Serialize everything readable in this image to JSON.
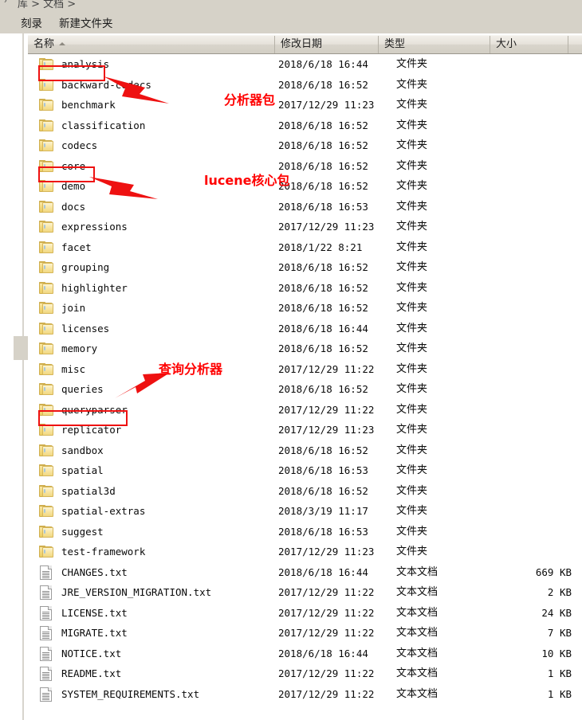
{
  "window": {
    "breadcrumb_partial": "库 > 文档 >",
    "chevron": "›"
  },
  "toolbar": {
    "burn_label": "刻录",
    "new_folder_label": "新建文件夹"
  },
  "columns": {
    "name": "名称",
    "date_modified": "修改日期",
    "type": "类型",
    "size": "大小",
    "sort_direction": "ascending"
  },
  "type_labels": {
    "folder": "文件夹",
    "text_document": "文本文档"
  },
  "files": [
    {
      "name": "analysis",
      "date": "2018/6/18 16:44",
      "type": "文件夹",
      "size": "",
      "icon": "folder-icon"
    },
    {
      "name": "backward-codecs",
      "date": "2018/6/18 16:52",
      "type": "文件夹",
      "size": "",
      "icon": "folder-icon"
    },
    {
      "name": "benchmark",
      "date": "2017/12/29 11:23",
      "type": "文件夹",
      "size": "",
      "icon": "folder-icon"
    },
    {
      "name": "classification",
      "date": "2018/6/18 16:52",
      "type": "文件夹",
      "size": "",
      "icon": "folder-icon"
    },
    {
      "name": "codecs",
      "date": "2018/6/18 16:52",
      "type": "文件夹",
      "size": "",
      "icon": "folder-icon"
    },
    {
      "name": "core",
      "date": "2018/6/18 16:52",
      "type": "文件夹",
      "size": "",
      "icon": "folder-icon"
    },
    {
      "name": "demo",
      "date": "2018/6/18 16:52",
      "type": "文件夹",
      "size": "",
      "icon": "folder-icon"
    },
    {
      "name": "docs",
      "date": "2018/6/18 16:53",
      "type": "文件夹",
      "size": "",
      "icon": "folder-icon"
    },
    {
      "name": "expressions",
      "date": "2017/12/29 11:23",
      "type": "文件夹",
      "size": "",
      "icon": "folder-icon"
    },
    {
      "name": "facet",
      "date": "2018/1/22 8:21",
      "type": "文件夹",
      "size": "",
      "icon": "folder-icon"
    },
    {
      "name": "grouping",
      "date": "2018/6/18 16:52",
      "type": "文件夹",
      "size": "",
      "icon": "folder-icon"
    },
    {
      "name": "highlighter",
      "date": "2018/6/18 16:52",
      "type": "文件夹",
      "size": "",
      "icon": "folder-icon"
    },
    {
      "name": "join",
      "date": "2018/6/18 16:52",
      "type": "文件夹",
      "size": "",
      "icon": "folder-icon"
    },
    {
      "name": "licenses",
      "date": "2018/6/18 16:44",
      "type": "文件夹",
      "size": "",
      "icon": "folder-icon"
    },
    {
      "name": "memory",
      "date": "2018/6/18 16:52",
      "type": "文件夹",
      "size": "",
      "icon": "folder-icon"
    },
    {
      "name": "misc",
      "date": "2017/12/29 11:22",
      "type": "文件夹",
      "size": "",
      "icon": "folder-icon"
    },
    {
      "name": "queries",
      "date": "2018/6/18 16:52",
      "type": "文件夹",
      "size": "",
      "icon": "folder-icon"
    },
    {
      "name": "queryparser",
      "date": "2017/12/29 11:22",
      "type": "文件夹",
      "size": "",
      "icon": "folder-icon"
    },
    {
      "name": "replicator",
      "date": "2017/12/29 11:23",
      "type": "文件夹",
      "size": "",
      "icon": "folder-icon"
    },
    {
      "name": "sandbox",
      "date": "2018/6/18 16:52",
      "type": "文件夹",
      "size": "",
      "icon": "folder-icon"
    },
    {
      "name": "spatial",
      "date": "2018/6/18 16:53",
      "type": "文件夹",
      "size": "",
      "icon": "folder-icon"
    },
    {
      "name": "spatial3d",
      "date": "2018/6/18 16:52",
      "type": "文件夹",
      "size": "",
      "icon": "folder-icon"
    },
    {
      "name": "spatial-extras",
      "date": "2018/3/19 11:17",
      "type": "文件夹",
      "size": "",
      "icon": "folder-icon"
    },
    {
      "name": "suggest",
      "date": "2018/6/18 16:53",
      "type": "文件夹",
      "size": "",
      "icon": "folder-icon"
    },
    {
      "name": "test-framework",
      "date": "2017/12/29 11:23",
      "type": "文件夹",
      "size": "",
      "icon": "folder-icon"
    },
    {
      "name": "CHANGES.txt",
      "date": "2018/6/18 16:44",
      "type": "文本文档",
      "size": "669 KB",
      "icon": "text-document-icon"
    },
    {
      "name": "JRE_VERSION_MIGRATION.txt",
      "date": "2017/12/29 11:22",
      "type": "文本文档",
      "size": "2 KB",
      "icon": "text-document-icon"
    },
    {
      "name": "LICENSE.txt",
      "date": "2017/12/29 11:22",
      "type": "文本文档",
      "size": "24 KB",
      "icon": "text-document-icon"
    },
    {
      "name": "MIGRATE.txt",
      "date": "2017/12/29 11:22",
      "type": "文本文档",
      "size": "7 KB",
      "icon": "text-document-icon"
    },
    {
      "name": "NOTICE.txt",
      "date": "2018/6/18 16:44",
      "type": "文本文档",
      "size": "10 KB",
      "icon": "text-document-icon"
    },
    {
      "name": "README.txt",
      "date": "2017/12/29 11:22",
      "type": "文本文档",
      "size": "1 KB",
      "icon": "text-document-icon"
    },
    {
      "name": "SYSTEM_REQUIREMENTS.txt",
      "date": "2017/12/29 11:22",
      "type": "文本文档",
      "size": "1 KB",
      "icon": "text-document-icon"
    }
  ],
  "annotations": {
    "color": "#ff0000",
    "items": [
      {
        "label": "分析器包",
        "target": "analysis"
      },
      {
        "label": "lucene核心包",
        "target": "core"
      },
      {
        "label": "查询分析器",
        "target": "queryparser"
      }
    ]
  }
}
